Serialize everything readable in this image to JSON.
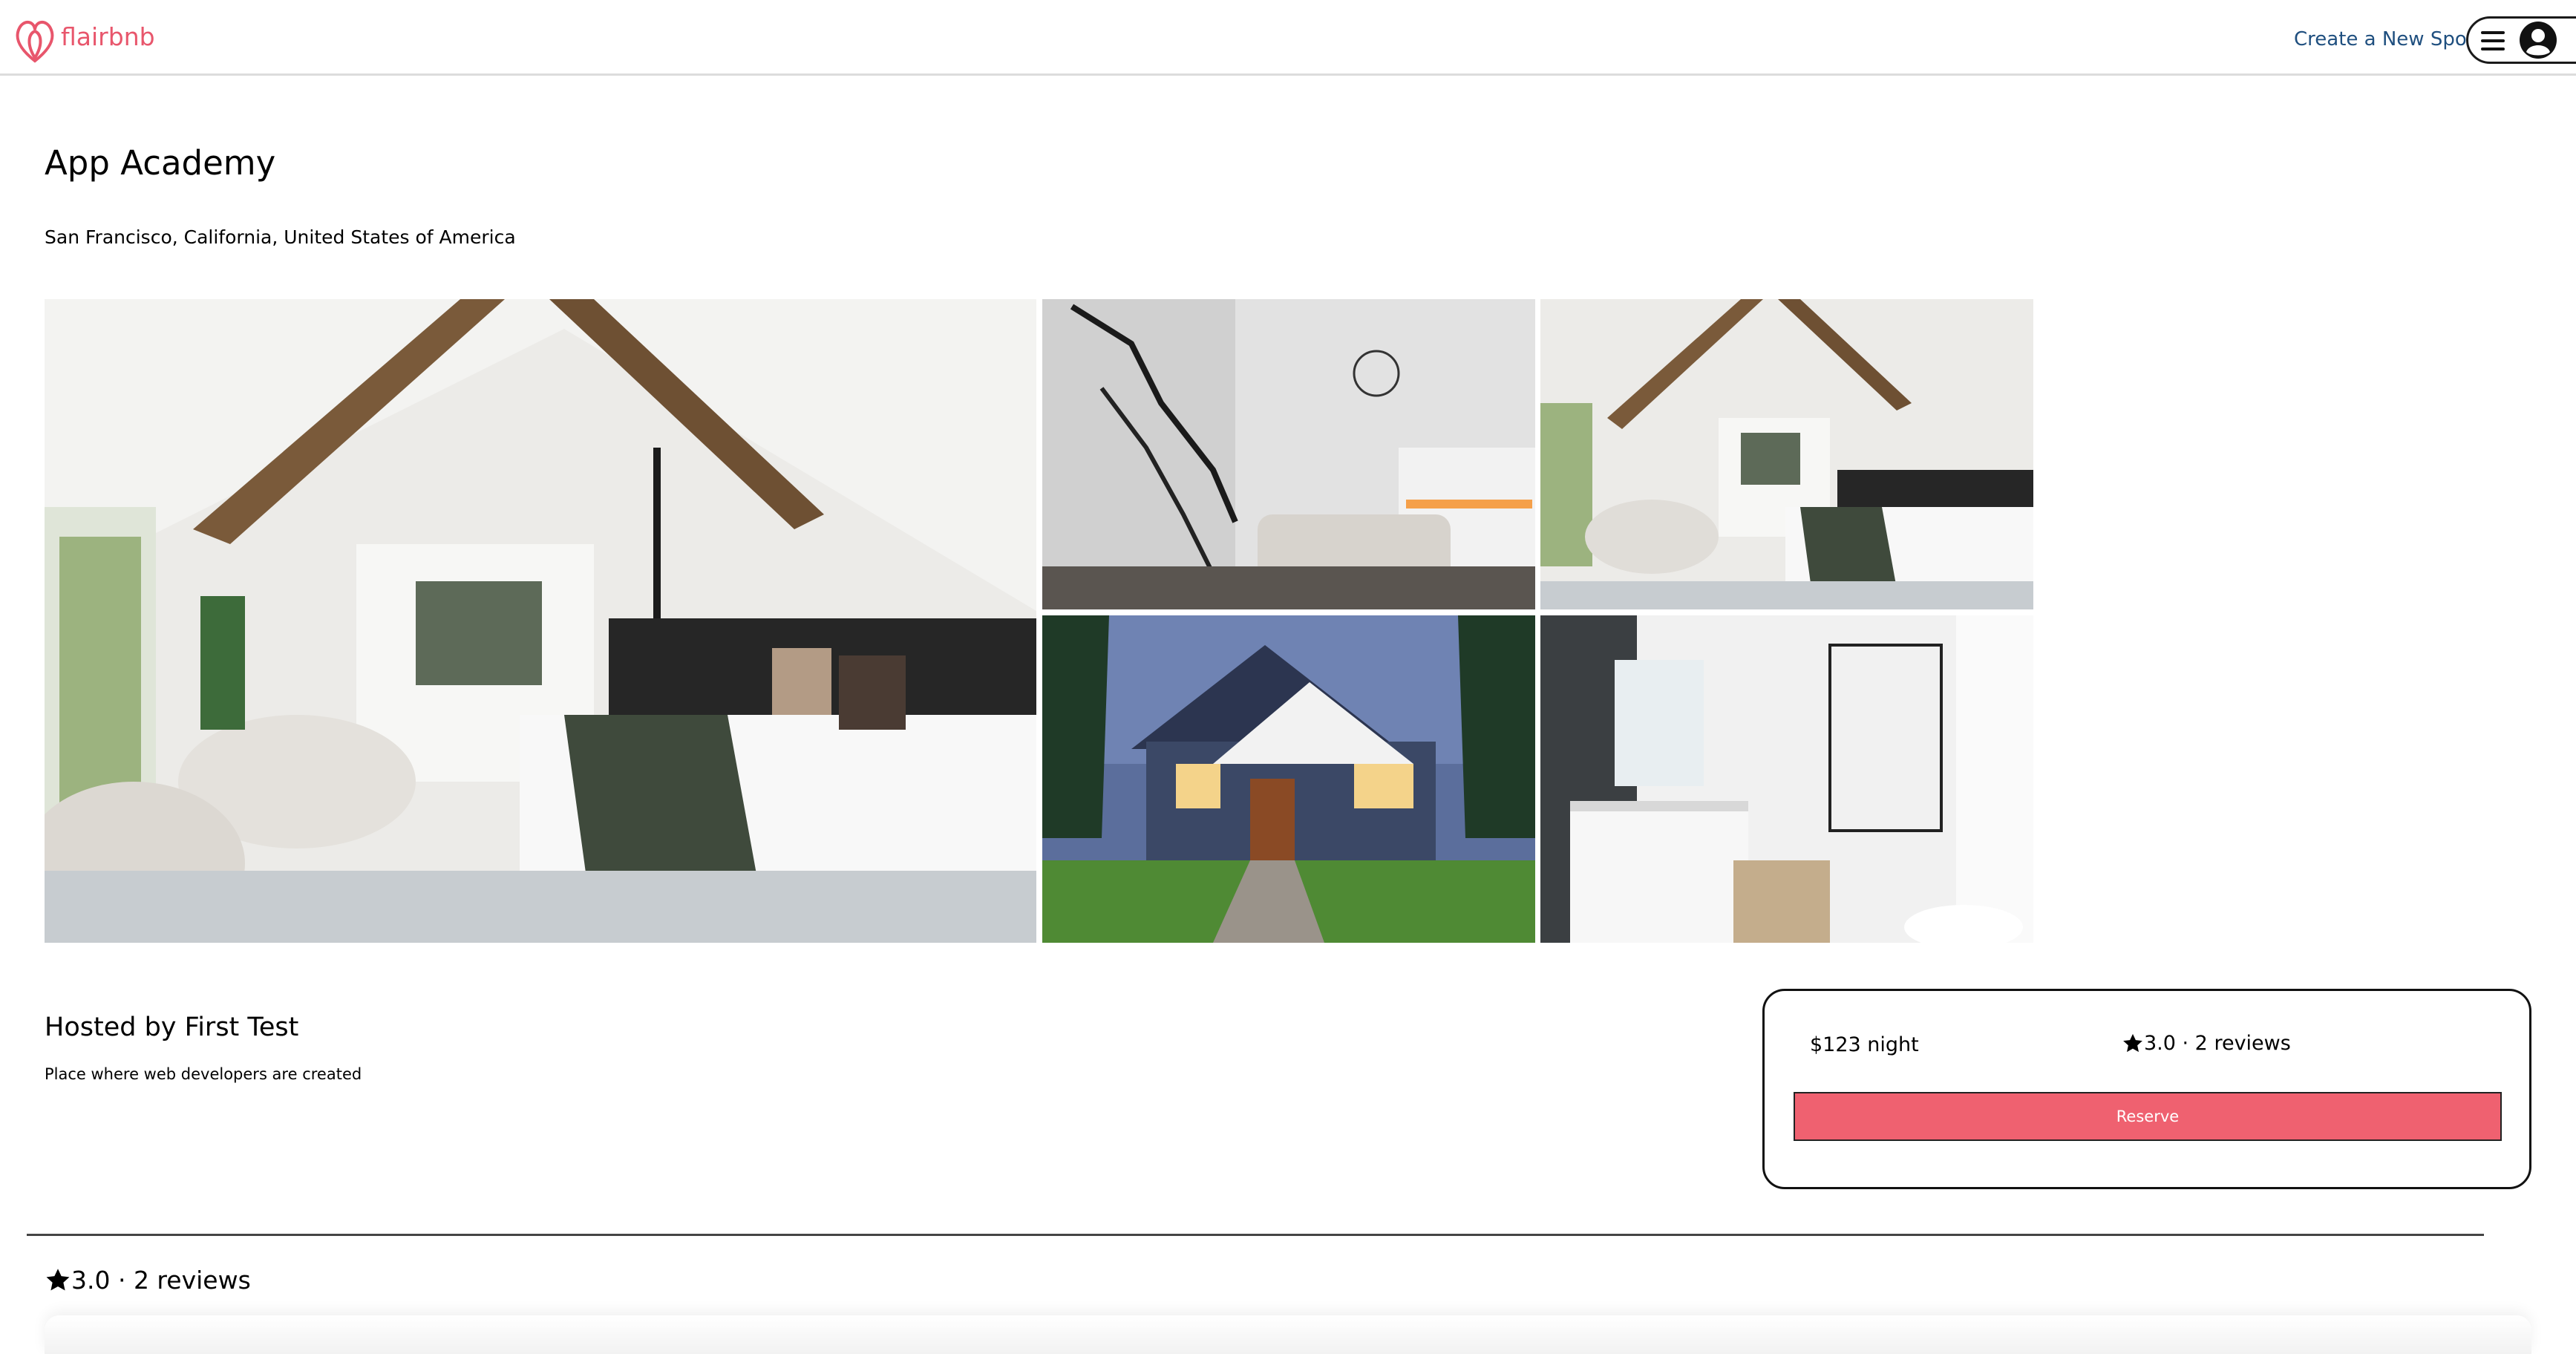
{
  "header": {
    "logo_text": "flairbnb",
    "create_link": "Create a New Spot",
    "brand_color": "#e8566c"
  },
  "spot": {
    "name": "App Academy",
    "location": "San Francisco, California, United States of America",
    "host": "Hosted by First Test",
    "description": "Place where web developers are created"
  },
  "gallery": {
    "images": [
      {
        "alt": "bedroom with vaulted ceiling"
      },
      {
        "alt": "living room with staircase"
      },
      {
        "alt": "bedroom"
      },
      {
        "alt": "house exterior"
      },
      {
        "alt": "bathroom"
      }
    ]
  },
  "booking": {
    "price": "$123 night",
    "rating": "3.0 · 2 reviews",
    "reserve_label": "Reserve",
    "button_color": "#ef6170"
  },
  "reviews": {
    "summary": "3.0 · 2 reviews"
  },
  "icons": {
    "logo": "flairbnb-logo-icon",
    "menu": "hamburger-menu-icon",
    "user": "user-avatar-icon",
    "star": "star-icon"
  }
}
